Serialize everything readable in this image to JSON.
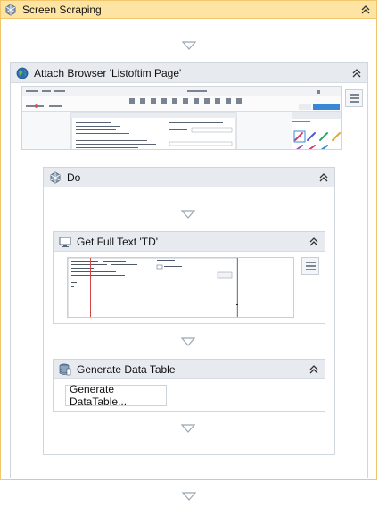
{
  "sequence": {
    "title": "Screen Scraping"
  },
  "attach_browser": {
    "title": "Attach Browser 'Listoftim Page'"
  },
  "do_block": {
    "title": "Do"
  },
  "get_full_text": {
    "title": "Get Full Text 'TD'"
  },
  "generate_table": {
    "title": "Generate Data Table",
    "button_label": "Generate DataTable..."
  },
  "colors": {
    "sequence_border": "#f2c66a",
    "sequence_header": "#fde4a3",
    "card_header": "#e7ebf0",
    "card_border": "#cfd6de",
    "arrow": "#9aa6b2"
  },
  "icons": [
    "sequence-icon",
    "globe-icon",
    "do-icon",
    "monitor-icon",
    "database-icon",
    "collapse-chevron-icon",
    "menu-icon",
    "down-arrow-icon"
  ]
}
